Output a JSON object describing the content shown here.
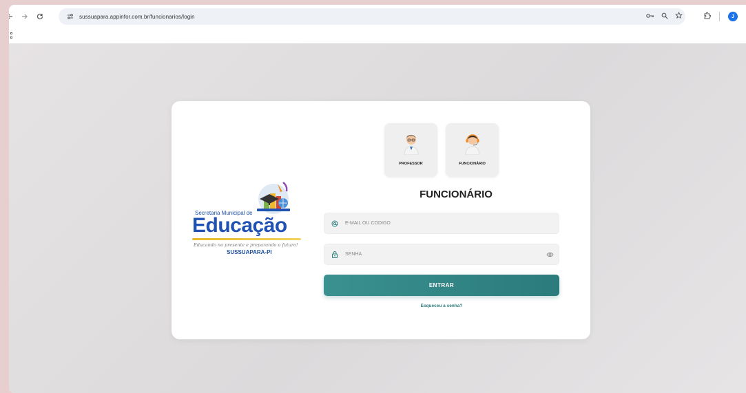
{
  "browser": {
    "url": "sussuapara.appinfor.com.br/funcionarios/login",
    "profile_initial": "J"
  },
  "logo": {
    "line1": "Secretaria Municipal de",
    "main": "Educação",
    "slogan": "Educando no presente e preparando o futuro!",
    "city": "SUSSUAPARA-PI"
  },
  "roles": [
    {
      "label": "PROFESSOR"
    },
    {
      "label": "FUNCIONÁRIO"
    }
  ],
  "form": {
    "title": "FUNCIONÁRIO",
    "email_placeholder": "E-MAIL OU CÓDIGO",
    "password_placeholder": "SENHA",
    "submit_label": "ENTRAR",
    "forgot_label": "Esqueceu a senha?"
  },
  "colors": {
    "accent": "#2b7b7c",
    "logo_blue": "#1f52b3",
    "logo_gold": "#e7b923",
    "frame_bg": "#e7cfd0"
  }
}
